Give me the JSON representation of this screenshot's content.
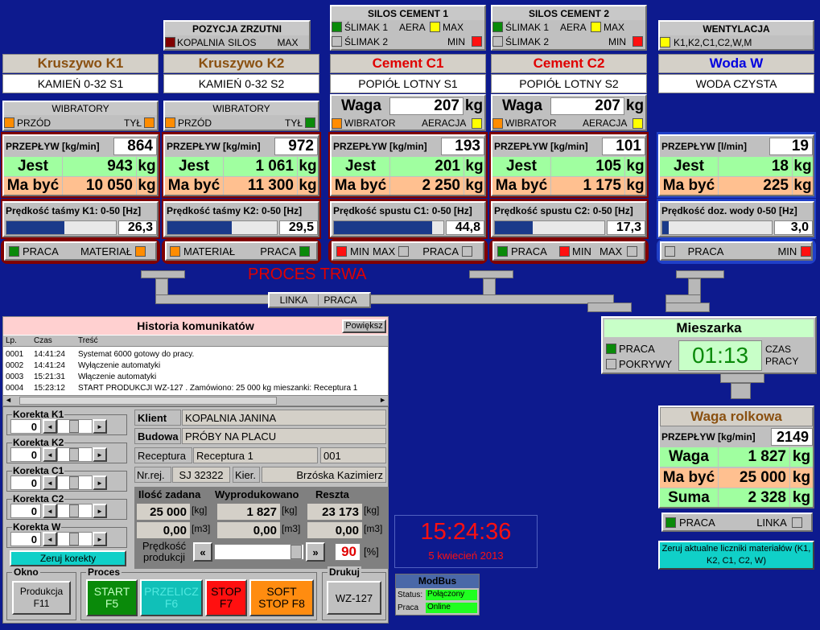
{
  "header": {
    "pozycja": {
      "title": "POZYCJA ZRZUTNI",
      "a": "KOPALNIA",
      "b": "SILOS",
      "c": "MAX"
    },
    "silos1": {
      "title": "SILOS CEMENT 1",
      "r1": [
        "ŚLIMAK 1",
        "AERA",
        "MAX"
      ],
      "r2": [
        "ŚLIMAK 2",
        "MIN"
      ]
    },
    "silos2": {
      "title": "SILOS CEMENT 2",
      "r1": [
        "ŚLIMAK 1",
        "AERA",
        "MAX"
      ],
      "r2": [
        "ŚLIMAK 2",
        "MIN"
      ]
    },
    "went": {
      "title": "WENTYLACJA",
      "label": "K1,K2,C1,C2,W,M"
    }
  },
  "columns": [
    {
      "title": "Kruszywo K1",
      "titleColor": "#8a5010",
      "sub": "KAMIEŃ 0-32 S1",
      "przeplyw_label": "PRZEPŁYW [kg/min]",
      "przeplyw": "864",
      "jest": "943",
      "mabyc": "10 050",
      "unit": "kg",
      "speed_label": "Prędkość taśmy K1:  0-50 [Hz]",
      "speed": "26,3",
      "fill": 0.526
    },
    {
      "title": "Kruszywo K2",
      "titleColor": "#8a5010",
      "sub": "KAMIEŃ 0-32 S2",
      "przeplyw_label": "PRZEPŁYW [kg/min]",
      "przeplyw": "972",
      "jest": "1 061",
      "mabyc": "11 300",
      "unit": "kg",
      "speed_label": "Prędkość taśmy K2:  0-50 [Hz]",
      "speed": "29,5",
      "fill": 0.59
    },
    {
      "title": "Cement C1",
      "titleColor": "#e00000",
      "sub": "POPIÓŁ LOTNY S1",
      "przeplyw_label": "PRZEPŁYW [kg/min]",
      "przeplyw": "193",
      "jest": "201",
      "mabyc": "2 250",
      "unit": "kg",
      "speed_label": "Prędkość spustu C1:  0-50 [Hz]",
      "speed": "44,8",
      "fill": 0.896
    },
    {
      "title": "Cement C2",
      "titleColor": "#e00000",
      "sub": "POPIÓŁ LOTNY S2",
      "przeplyw_label": "PRZEPŁYW [kg/min]",
      "przeplyw": "101",
      "jest": "105",
      "mabyc": "1 175",
      "unit": "kg",
      "speed_label": "Prędkość spustu C2:  0-50 [Hz]",
      "speed": "17,3",
      "fill": 0.346
    },
    {
      "title": "Woda W",
      "titleColor": "#0000e0",
      "sub": "WODA CZYSTA",
      "przeplyw_label": "PRZEPŁYW [l/min]",
      "przeplyw": "19",
      "jest": "18",
      "mabyc": "225",
      "unit": "kg",
      "speed_label": "Prędkość doz. wody 0-50 [Hz]",
      "speed": "3,0",
      "fill": 0.06
    }
  ],
  "labels": {
    "jest": "Jest",
    "mabyc": "Ma być",
    "wibratory": "WIBRATORY",
    "przod": "PRZÓD",
    "tyl": "TYŁ",
    "waga": "Waga",
    "wibrator": "WIBRATOR",
    "aeracja": "AERACJA",
    "praca": "PRACA",
    "material": "MATERIAŁ",
    "min": "MIN",
    "max": "MAX"
  },
  "waga_c1": "207",
  "waga_c2": "207",
  "proces_trwa": "PROCES TRWA",
  "linka": {
    "a": "LINKA",
    "b": "PRACA"
  },
  "mieszarka": {
    "title": "Mieszarka",
    "praca": "PRACA",
    "pokrywy": "POKRYWY",
    "time": "01:13",
    "czas": "CZAS PRACY"
  },
  "waga_rolkowa": {
    "title": "Waga rolkowa",
    "przeplyw_label": "PRZEPŁYW [kg/min]",
    "przeplyw": "2149",
    "waga_label": "Waga",
    "waga": "1 827",
    "mabyc_label": "Ma być",
    "mabyc": "25 000",
    "suma_label": "Suma",
    "suma": "2 328",
    "unit": "kg",
    "praca": "PRACA",
    "linka": "LINKA"
  },
  "zeruj_liczniki": "Zeruj aktualne liczniki materiałów (K1, K2, C1, C2, W)",
  "historia": {
    "title": "Historia komunikatów",
    "powieksz": "Powiększ",
    "cols": [
      "Lp.",
      "Czas",
      "Treść"
    ],
    "rows": [
      [
        "0001",
        "14:41:24",
        "Systemat 6000 gotowy do pracy."
      ],
      [
        "0002",
        "14:41:24",
        "Wyłączenie automatyki"
      ],
      [
        "0003",
        "15:21:31",
        "Włączenie automatyki"
      ],
      [
        "0004",
        "15:23:12",
        "START PRODUKCJI WZ-127 . Zamówiono: 25 000 kg mieszanki: Receptura 1"
      ]
    ]
  },
  "korekty": [
    {
      "label": "Korekta K1",
      "value": "0"
    },
    {
      "label": "Korekta K2",
      "value": "0"
    },
    {
      "label": "Korekta C1",
      "value": "0"
    },
    {
      "label": "Korekta C2",
      "value": "0"
    },
    {
      "label": "Korekta W",
      "value": "0"
    }
  ],
  "zeruj_korekty": "Zeruj korekty",
  "order": {
    "klient_l": "Klient",
    "klient": "KOPALNIA JANINA",
    "budowa_l": "Budowa",
    "budowa": "PRÓBY NA PLACU",
    "receptura_l": "Receptura",
    "receptura": "Receptura 1",
    "receptura_no": "001",
    "nrrej_l": "Nr.rej.",
    "nrrej": "SJ 32322",
    "kier_l": "Kier.",
    "kier": "Brzóska Kazimierz"
  },
  "prod": {
    "h1": "Ilość zadana",
    "h2": "Wyprodukowano",
    "h3": "Reszta",
    "v1": "25 000",
    "v2": "1 827",
    "v3": "23 173",
    "u1": "[kg]",
    "m1": "0,00",
    "m2": "0,00",
    "m3": "0,00",
    "u2": "[m3]",
    "speed_label": "Prędkość produkcji",
    "speed": "90",
    "pct": "[%]",
    "lft": "«",
    "rgt": "»"
  },
  "clock": {
    "time": "15:24:36",
    "date": "5 kwiecień 2013"
  },
  "modbus": {
    "title": "ModBus",
    "status_l": "Status:",
    "status": "Połączony",
    "praca_l": "Praca",
    "praca": "Online"
  },
  "okno": {
    "label": "Okno",
    "btn": "Produkcja F11"
  },
  "proces": {
    "label": "Proces",
    "start": "START F5",
    "przelicz": "PRZELICZ F6",
    "stop": "STOP F7",
    "soft": "SOFT STOP F8"
  },
  "drukuj": {
    "label": "Drukuj",
    "btn": "WZ-127"
  }
}
